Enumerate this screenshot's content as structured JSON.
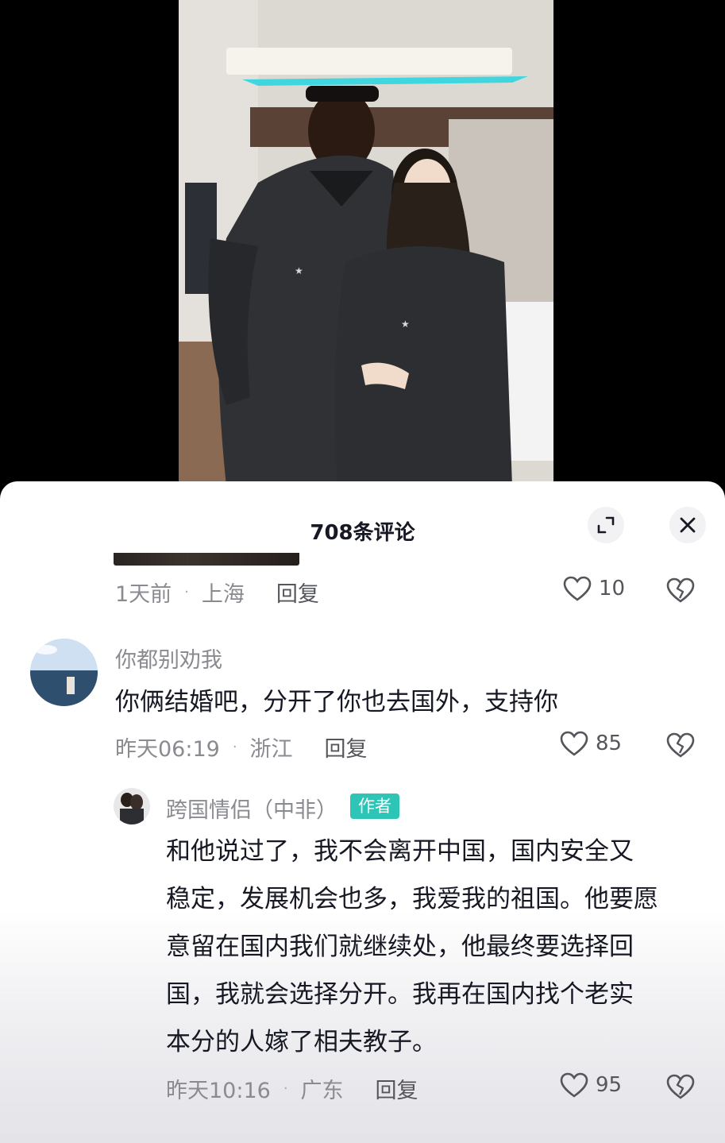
{
  "sheet": {
    "title": "708条评论"
  },
  "icons": {
    "expand": "expand-icon",
    "close": "close-icon",
    "like": "heart-outline-icon",
    "dislike": "broken-heart-icon"
  },
  "comments": [
    {
      "time": "1天前",
      "location": "上海",
      "reply_label": "回复",
      "likes": "10"
    },
    {
      "username": "你都别劝我",
      "text": "你俩结婚吧，分开了你也去国外，支持你",
      "time": "昨天06:19",
      "location": "浙江",
      "reply_label": "回复",
      "likes": "85"
    },
    {
      "username": "跨国情侣（中非）",
      "badge": "作者",
      "text": [
        "和他说过了，我不会离开中国，国内安全又",
        "稳定，发展机会也多，我爱我的祖国。他要愿",
        "意留在国内我们就继续处，他最终要选择回",
        "国，我就会选择分开。我再在国内找个老实",
        "本分的人嫁了相夫教子。"
      ],
      "time": "昨天10:16",
      "location": "广东",
      "reply_label": "回复",
      "likes": "95"
    }
  ]
}
